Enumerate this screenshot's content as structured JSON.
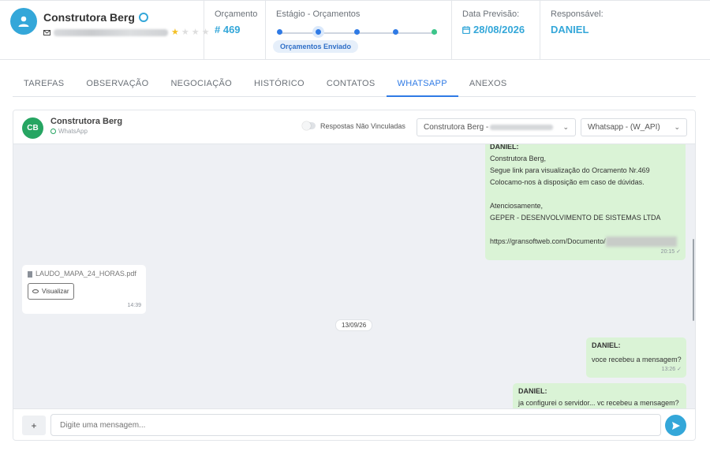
{
  "client": {
    "name": "Construtora Berg",
    "rating": 1,
    "rating_max": 4
  },
  "orcamento": {
    "label": "Orçamento",
    "value": "# 469"
  },
  "stage": {
    "label": "Estágio - Orçamentos",
    "current": "Orçamentos Enviado",
    "steps": 5,
    "active_index": 1
  },
  "previsao": {
    "label": "Data Previsão:",
    "value": "28/08/2026"
  },
  "responsavel": {
    "label": "Responsável:",
    "value": "DANIEL"
  },
  "tabs": [
    {
      "label": "TAREFAS",
      "active": false
    },
    {
      "label": "OBSERVAÇÃO",
      "active": false
    },
    {
      "label": "NEGOCIAÇÃO",
      "active": false
    },
    {
      "label": "HISTÓRICO",
      "active": false
    },
    {
      "label": "CONTATOS",
      "active": false
    },
    {
      "label": "WHATSAPP",
      "active": true
    },
    {
      "label": "ANEXOS",
      "active": false
    }
  ],
  "chat": {
    "avatar_initials": "CB",
    "name": "Construtora Berg",
    "subtitle": "WhatsApp",
    "toggle_label": "Respostas Não Vinculadas",
    "contact_select": "Construtora Berg -",
    "channel_select": "Whatsapp - (W_API)",
    "input_placeholder": "Digite uma mensagem...",
    "add_label": "+",
    "messages": {
      "m1": {
        "sender": "DANIEL:",
        "lines": [
          "Construtora Berg,",
          "Segue link para visualização do Orcamento Nr.469",
          "Colocamo-nos à disposição em caso de dúvidas.",
          "",
          "Atenciosamente,",
          "GEPER - DESENVOLVIMENTO DE SISTEMAS LTDA",
          ""
        ],
        "link": "https://gransoftweb.com/Documento/",
        "time": "20:15 ✓"
      },
      "m2": {
        "file_name": "LAUDO_MAPA_24_HORAS.pdf",
        "button": "Visualizar",
        "time": "14:39"
      },
      "date_separator": "13/09/26",
      "m3": {
        "sender": "DANIEL:",
        "text": "voce recebeu a mensagem?",
        "time": "13:26 ✓"
      },
      "m4": {
        "sender": "DANIEL:",
        "text": "ja configurei o servidor... vc recebeu a mensagem?"
      }
    }
  },
  "colors": {
    "accent": "#34a7d9",
    "stage_blue": "#2f7ae5",
    "outgoing_bubble": "#daf3d6",
    "chat_bg": "#eef0f4",
    "avatar_green": "#26a562"
  }
}
